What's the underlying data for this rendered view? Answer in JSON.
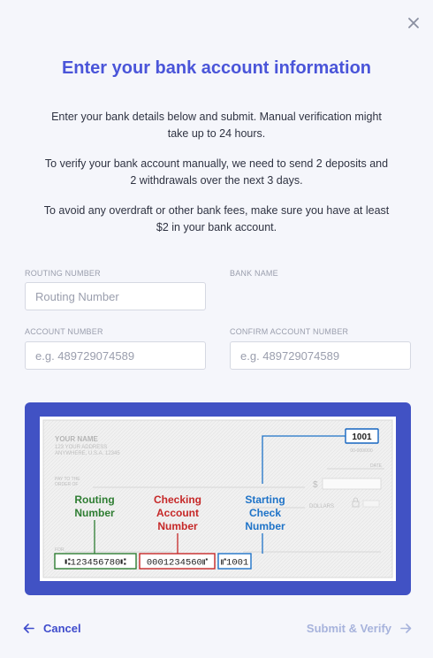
{
  "title": "Enter your bank account information",
  "paragraphs": [
    "Enter your bank details below and submit. Manual verification might take up to 24 hours.",
    "To verify your bank account manually, we need to send 2 deposits and 2 withdrawals over the next 3 days.",
    "To avoid any overdraft or other bank fees, make sure you have at least $2 in your bank account."
  ],
  "form": {
    "routing_label": "ROUTING NUMBER",
    "routing_placeholder": "Routing Number",
    "bank_name_label": "BANK NAME",
    "account_label": "ACCOUNT NUMBER",
    "account_placeholder": "e.g. 489729074589",
    "confirm_label": "CONFIRM ACCOUNT NUMBER",
    "confirm_placeholder": "e.g. 489729074589"
  },
  "check": {
    "name": "YOUR NAME",
    "address1": "123 YOUR ADDRESS",
    "address2": "ANYWHERE, U.S.A. 12345",
    "check_number": "1001",
    "fraction": "00-000/000",
    "date_label": "DATE",
    "pay_to_1": "PAY TO THE",
    "pay_to_2": "ORDER OF",
    "dollar_sign": "$",
    "dollars_label": "DOLLARS",
    "for_label": "FOR",
    "routing_caption_1": "Routing",
    "routing_caption_2": "Number",
    "checking_caption_1": "Checking",
    "checking_caption_2": "Account",
    "checking_caption_3": "Number",
    "starting_caption_1": "Starting",
    "starting_caption_2": "Check",
    "starting_caption_3": "Number",
    "micr_routing": "⑆123456780⑆",
    "micr_account": "0001234560⑈",
    "micr_check": "⑈1001",
    "colors": {
      "routing": "#2e7d32",
      "account": "#c62828",
      "check": "#1565c0"
    }
  },
  "footer": {
    "cancel_label": "Cancel",
    "submit_label": "Submit & Verify"
  },
  "icons": {
    "close": "close-icon",
    "back": "arrow-left-icon",
    "forward": "arrow-right-icon"
  }
}
